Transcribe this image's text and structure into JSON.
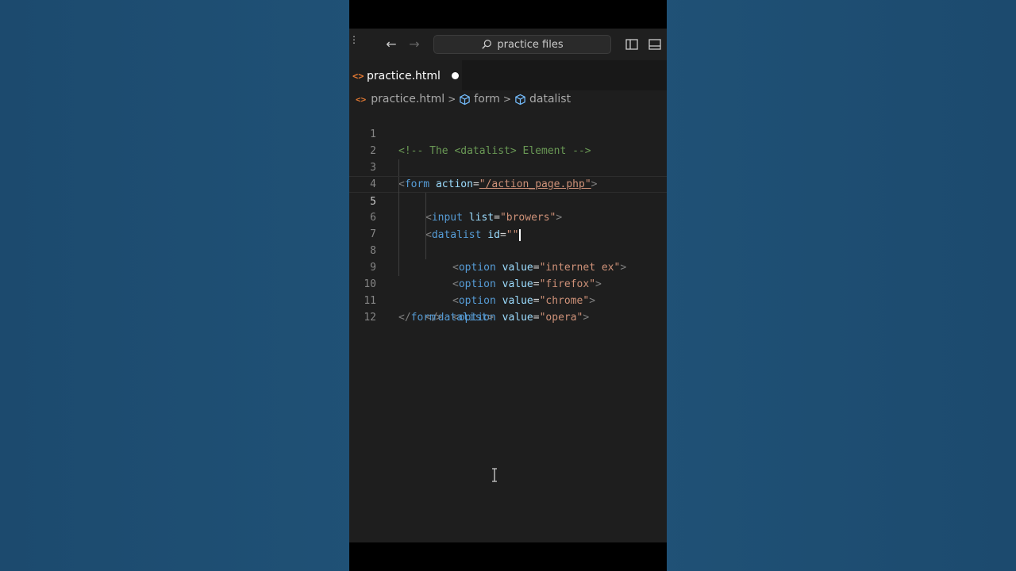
{
  "search": {
    "label": "practice files"
  },
  "tab": {
    "icon": "<>",
    "label": "practice.html"
  },
  "breadcrumb": {
    "icon": "<>",
    "file": "practice.html",
    "items": [
      "form",
      "datalist"
    ]
  },
  "code": {
    "ln": [
      "1",
      "2",
      "3",
      "4",
      "5",
      "6",
      "7",
      "8",
      "9",
      "10",
      "11",
      "12"
    ],
    "l1": "<!-- The <datalist> Element -->",
    "l3": {
      "lt": "<",
      "tag": "form",
      "attr": "action",
      "eq": "=",
      "val": "\"/action_page.php\"",
      "gt": ">"
    },
    "l4": {
      "lt": "<",
      "tag": "input",
      "attr": "list",
      "eq": "=",
      "val": "\"browers\"",
      "gt": ">"
    },
    "l5": {
      "lt": "<",
      "tag": "datalist",
      "attr": "id",
      "eq": "=",
      "val": "\"\""
    },
    "l6": {
      "lt": "<",
      "tag": "option",
      "attr": "value",
      "eq": "=",
      "val": "\"internet ex\"",
      "gt": ">"
    },
    "l7": {
      "lt": "<",
      "tag": "option",
      "attr": "value",
      "eq": "=",
      "val": "\"firefox\"",
      "gt": ">"
    },
    "l8": {
      "lt": "<",
      "tag": "option",
      "attr": "value",
      "eq": "=",
      "val": "\"chrome\"",
      "gt": ">"
    },
    "l9": {
      "lt": "<",
      "tag": "option",
      "attr": "value",
      "eq": "=",
      "val": "\"opera\"",
      "gt": ">"
    },
    "l10": {
      "lt": "</",
      "tag": "datalist",
      "gt": ">"
    },
    "l11": {
      "lt": "</",
      "tag": "form",
      "gt": ">"
    }
  },
  "colors": {
    "background": "#1f5075",
    "editor": "#1e1e1e",
    "tag": "#569cd6",
    "attr": "#9cdcfe",
    "string": "#ce9178",
    "comment": "#6a9955",
    "file_icon": "#e37933"
  },
  "icons": [
    "menu-dots-icon",
    "back-arrow-icon",
    "forward-arrow-icon",
    "search-icon",
    "sidebar-toggle-icon",
    "panel-toggle-icon",
    "html-file-icon",
    "chevron-right-icon",
    "symbol-cube-icon",
    "text-cursor-icon"
  ]
}
